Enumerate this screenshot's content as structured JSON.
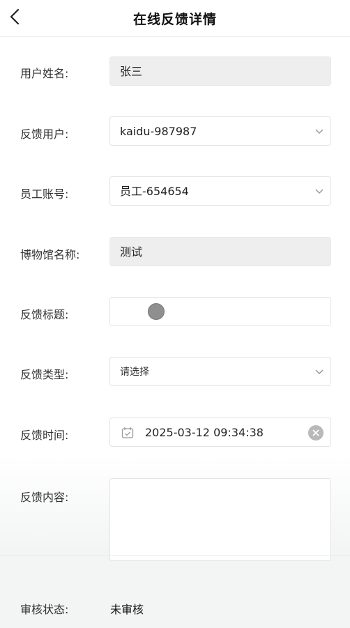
{
  "header": {
    "title": "在线反馈详情"
  },
  "form": {
    "user_name": {
      "label": "用户姓名:",
      "value": "张三"
    },
    "feedback_user": {
      "label": "反馈用户:",
      "value": "kaidu-987987"
    },
    "staff_account": {
      "label": "员工账号:",
      "value": "员工-654654"
    },
    "museum_name": {
      "label": "博物馆名称:",
      "value": "测试"
    },
    "feedback_title": {
      "label": "反馈标题:",
      "value": ""
    },
    "feedback_type": {
      "label": "反馈类型:",
      "placeholder": "请选择"
    },
    "feedback_time": {
      "label": "反馈时间:",
      "value": "2025-03-12 09:34:38"
    },
    "feedback_content": {
      "label": "反馈内容:",
      "value": ""
    },
    "review_status": {
      "label": "审核状态:",
      "value": "未审核"
    }
  },
  "icons": {
    "back": "chevron-left-icon",
    "dropdown": "chevron-down-icon",
    "calendar": "calendar-icon",
    "clear": "clear-icon"
  }
}
